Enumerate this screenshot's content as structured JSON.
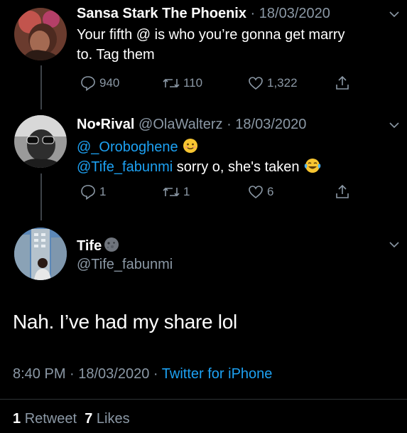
{
  "tweet1": {
    "name": "Sansa Stark The Phoenix",
    "date": "· 18/03/2020",
    "text_line1": "Your fifth @ is who you’re gonna get marry",
    "text_line2": "to. Tag them",
    "replies": "940",
    "retweets": "110",
    "likes": "1,322"
  },
  "tweet2": {
    "name": "No•Rival",
    "handle": "@OlaWalterz",
    "date": "· 18/03/2020",
    "mention1": "@_Oroboghene",
    "mention2": "@Tife_fabunmi",
    "text": " sorry o, she's taken",
    "replies": "1",
    "retweets": "1",
    "likes": "6"
  },
  "main_tweet": {
    "name": "Tife",
    "handle": "@Tife_fabunmi",
    "text": "Nah. I’ve had my share lol",
    "time_date": "8:40 PM · 18/03/2020 ·",
    "source": "Twitter for iPhone",
    "retweet_count": "1",
    "retweet_label": "Retweet",
    "like_count": "7",
    "like_label": "Likes"
  },
  "icons": [
    "reply-icon",
    "retweet-icon",
    "like-icon",
    "share-icon",
    "chevron-down-icon",
    "smiling-emoji-icon",
    "tears-of-joy-emoji-icon",
    "new-moon-face-emoji-icon"
  ],
  "colors": {
    "background": "#000000",
    "link": "#1da1f2",
    "muted": "#8b98a5"
  }
}
